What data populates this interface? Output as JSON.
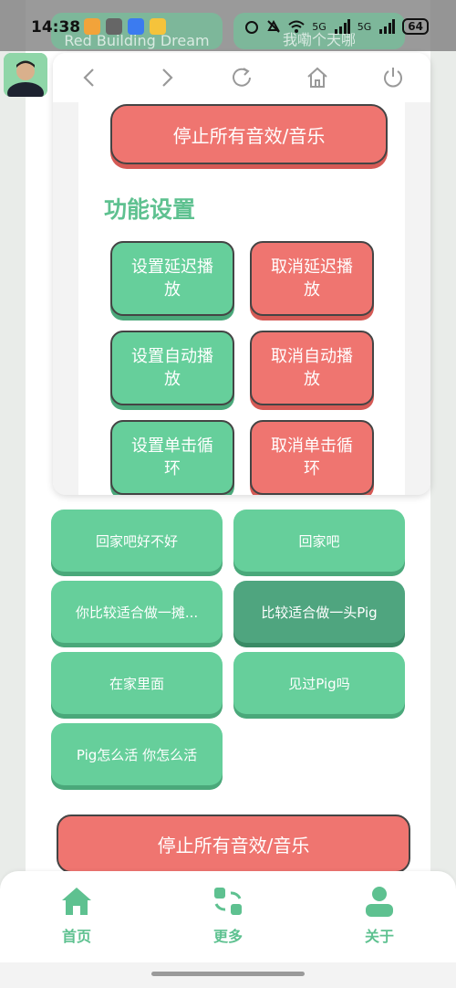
{
  "status_bar": {
    "time": "14:38",
    "network": "5G",
    "battery": "64"
  },
  "background": {
    "ghost_buttons": [
      "Red Building Dream",
      "我嘞个天哪"
    ],
    "buttons": [
      {
        "label": "回家吧好不好",
        "dark": false
      },
      {
        "label": "回家吧",
        "dark": false
      },
      {
        "label": "你比较适合做一摊...",
        "dark": false
      },
      {
        "label": "比较适合做一头Pig",
        "dark": true
      },
      {
        "label": "在家里面",
        "dark": false
      },
      {
        "label": "见过Pig吗",
        "dark": false
      },
      {
        "label": "Pig怎么活 你怎么活",
        "dark": false
      }
    ],
    "stop_all": "停止所有音效/音乐"
  },
  "popup": {
    "stop_all": "停止所有音效/音乐",
    "section_title": "功能设置",
    "buttons": [
      {
        "label": "设置延迟播放",
        "type": "green"
      },
      {
        "label": "取消延迟播放",
        "type": "red"
      },
      {
        "label": "设置自动播放",
        "type": "green"
      },
      {
        "label": "取消自动播放",
        "type": "red"
      },
      {
        "label": "设置单击循环",
        "type": "green"
      },
      {
        "label": "取消单击循环",
        "type": "red"
      }
    ]
  },
  "tabbar": {
    "items": [
      {
        "label": "首页",
        "icon": "home-icon"
      },
      {
        "label": "更多",
        "icon": "more-icon"
      },
      {
        "label": "关于",
        "icon": "user-icon"
      }
    ]
  },
  "colors": {
    "accent_green": "#66cf9b",
    "dark_green": "#4fa57f",
    "red": "#ef7570",
    "title_green": "#5ec190"
  }
}
